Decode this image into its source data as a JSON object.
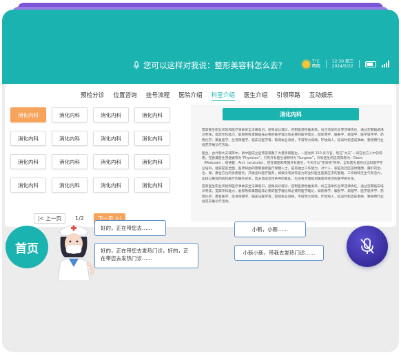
{
  "header": {
    "voice_prompt": "您可以这样对我说：整形美容科怎么去？",
    "weather_temp": "7°C",
    "weather_desc": "晴朗",
    "time": "12:30",
    "weekday": "周三",
    "date": "2024/5/22"
  },
  "nav": {
    "items": [
      "预检分诊",
      "位置咨询",
      "挂号流程",
      "医院介绍",
      "科室介绍",
      "医生介绍",
      "引领带路",
      "互动娱乐"
    ],
    "active_index": 4
  },
  "departments": {
    "items": [
      "消化内科",
      "消化内科",
      "消化内科",
      "消化内科",
      "消化内科",
      "消化内科",
      "消化内科",
      "消化内科",
      "消化内科",
      "消化内科",
      "消化内科",
      "消化内科",
      "消化内科",
      "消化内科",
      "消化内科",
      "消化内科"
    ],
    "active_index": 0
  },
  "pager": {
    "prev_label": "|< 上一页",
    "page_indicator": "1/2",
    "next_label": "下一页 >|"
  },
  "detail": {
    "title": "消化内科",
    "paragraphs": [
      "提高医生职业风险和医疗事故安全法律意识，避免误诊漏诊，控制医源性推发率，纠正违章作业零违律责任，通过定期临床培训考核，提高专科能力，能够熟练掌握临床必要的医学理论和必要的医学理论，如影像学、解剖学、病理学、医学遗传学、药物化学、康复医学、生育保健学、临床法医学等，取得执业资格，不得夸大病情，吓唬病人，延误时机造成事故，要按预行业规范开展诊疗活动。",
      "医生，古代称大夫或郎中，新中国成立后普提满我了大量赤脚医生，一度达到 150 多万名。现在“大夫”一词在北方人中仍常用。在欧美医生普遍被称为“Physician”，只有外科医生被称呼为“Surgeon”，外科医生的这说得称为：Decin（Medusan），德语是：Arzt（arutsuto），但在美国和英国外科医生，今天还以“密哥顿”称呼，全科医生是经过全科医学专业培训，能获提前全面，医师将由的需要重新医疗保健人士，是有独立工作能力，对个人、家庭及社区提供健康，廉价的治、治、保、康全方位的优质服务，开展全科医疗服务，如果没有具有该力的全科医生医家应求的基础，工作将缺乏生气和活力，加辩以某程的有科医疗的服务体系，势必造成急性条序的紊乱，也没有合理规划国家的经济的医学研生生。",
      "提高医生职业风险和医疗事故安全法律意识，避免误诊漏诊，控制医源性推发率，纠正违章作业零违律责任，通过定期临床培训考核，提高专科能力，能够熟练掌握临床必要的医学理论和必要的医学理论，如影像学、解剖学、病理学、医学遗传学、药物化学、康复医学、生育保健学、临床法医学等，取得执业资格，不得夸大病情，吓唬病人，延误时机造成事故，要按预行业规范开展诊疗活动。"
    ]
  },
  "conversation": {
    "home_label": "首页",
    "robot_1": "好的，正在带您去……",
    "robot_2": "好的，正在带您去发热门诊，好的，正在带您去发热门诊……",
    "user_1": "小新，小新……",
    "user_2": "小新小新，带我去发热门诊……"
  },
  "colors": {
    "accent": "#1bb3b0",
    "highlight": "#f7a35b",
    "bubble_border": "#5b8fc9",
    "mic_bg": "#3a2fa8"
  }
}
